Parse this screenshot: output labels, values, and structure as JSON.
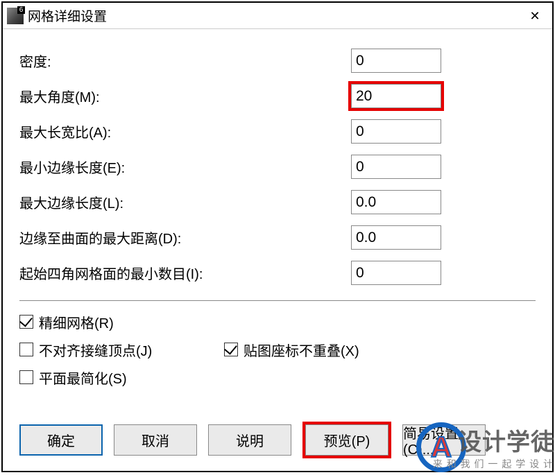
{
  "window": {
    "title": "网格详细设置",
    "close_glyph": "✕"
  },
  "fields": {
    "density": {
      "label": "密度:",
      "value": "0"
    },
    "max_angle": {
      "label": "最大角度(M):",
      "value": "20"
    },
    "max_aspect": {
      "label": "最大长宽比(A):",
      "value": "0"
    },
    "min_edge": {
      "label": "最小边缘长度(E):",
      "value": "0"
    },
    "max_edge": {
      "label": "最大边缘长度(L):",
      "value": "0.0"
    },
    "max_dist": {
      "label": "边缘至曲面的最大距离(D):",
      "value": "0.0"
    },
    "init_quad": {
      "label": "起始四角网格面的最小数目(I):",
      "value": "0"
    }
  },
  "checks": {
    "refine": {
      "label": "精细网格(R)",
      "checked": true
    },
    "jagged": {
      "label": "不对齐接缝顶点(J)",
      "checked": false
    },
    "pack_tex": {
      "label": "贴图座标不重叠(X)",
      "checked": true
    },
    "simple_plane": {
      "label": "平面最简化(S)",
      "checked": false
    }
  },
  "buttons": {
    "ok": "确定",
    "cancel": "取消",
    "help": "说明",
    "preview": "预览(P)",
    "simple": "简易设置(C)..."
  },
  "watermark": {
    "big": "设计学徒",
    "small": "来 和 我 们 一 起 学 设 计",
    "letter": "A"
  }
}
